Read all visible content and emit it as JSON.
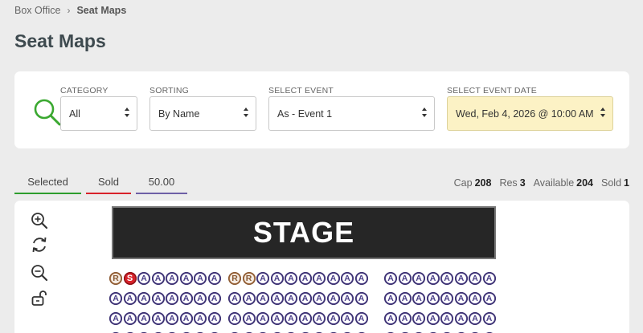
{
  "breadcrumb": {
    "root": "Box Office",
    "current": "Seat Maps"
  },
  "page_title": "Seat Maps",
  "filters": {
    "category": {
      "label": "CATEGORY",
      "value": "All"
    },
    "sorting": {
      "label": "SORTING",
      "value": "By Name"
    },
    "event": {
      "label": "SELECT EVENT",
      "value": "As - Event 1"
    },
    "date": {
      "label": "SELECT EVENT DATE",
      "value": "Wed, Feb 4, 2026 @ 10:00 AM"
    }
  },
  "legend": [
    {
      "label": "Selected",
      "color": "#2e9e2e"
    },
    {
      "label": "Sold",
      "color": "#d8222a"
    },
    {
      "label": "50.00",
      "color": "#6d5fa6"
    }
  ],
  "stats": {
    "cap_label": "Cap",
    "cap": "208",
    "res_label": "Res",
    "res": "3",
    "available_label": "Available",
    "available": "204",
    "sold_label": "Sold",
    "sold": "1"
  },
  "stage_label": "STAGE",
  "tools": [
    "zoom-in-icon",
    "refresh-icon",
    "zoom-out-icon",
    "unlock-icon"
  ],
  "colors": {
    "available": "#6d5fa6",
    "reserved": "#c58a5a",
    "sold": "#d8222a",
    "highlight": "#fcf2c5"
  },
  "seat_rows": [
    {
      "blocks": [
        [
          "R",
          "S",
          "A",
          "A",
          "A",
          "A",
          "A",
          "A"
        ],
        [
          "R",
          "R",
          "A",
          "A",
          "A",
          "A",
          "A",
          "A",
          "A",
          "A"
        ],
        [
          "A",
          "A",
          "A",
          "A",
          "A",
          "A",
          "A",
          "A"
        ]
      ]
    },
    {
      "blocks": [
        [
          "A",
          "A",
          "A",
          "A",
          "A",
          "A",
          "A",
          "A"
        ],
        [
          "A",
          "A",
          "A",
          "A",
          "A",
          "A",
          "A",
          "A",
          "A",
          "A"
        ],
        [
          "A",
          "A",
          "A",
          "A",
          "A",
          "A",
          "A",
          "A"
        ]
      ]
    },
    {
      "blocks": [
        [
          "A",
          "A",
          "A",
          "A",
          "A",
          "A",
          "A",
          "A"
        ],
        [
          "A",
          "A",
          "A",
          "A",
          "A",
          "A",
          "A",
          "A",
          "A",
          "A"
        ],
        [
          "A",
          "A",
          "A",
          "A",
          "A",
          "A",
          "A",
          "A"
        ]
      ]
    },
    {
      "blocks": [
        [
          "A",
          "A",
          "A",
          "A",
          "A",
          "A",
          "A",
          "A"
        ],
        [
          "A",
          "A",
          "A",
          "A",
          "A",
          "A",
          "A",
          "A",
          "A",
          "A"
        ],
        [
          "A",
          "A",
          "A",
          "A",
          "A",
          "A",
          "A",
          "A"
        ]
      ]
    }
  ]
}
